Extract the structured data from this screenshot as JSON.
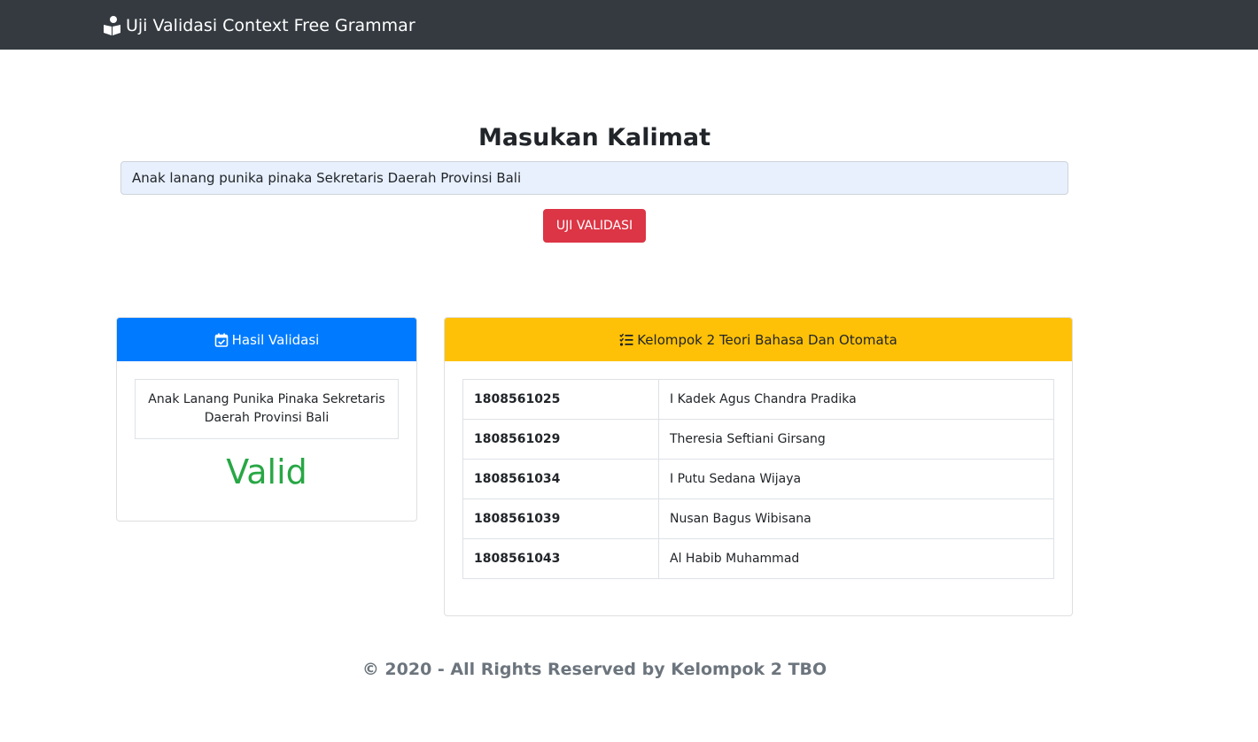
{
  "navbar": {
    "brand_icon": "book-reader-icon",
    "brand_text": "Uji Validasi Context Free Grammar"
  },
  "form": {
    "heading": "Masukan Kalimat",
    "input_value": "Anak lanang punika pinaka Sekretaris Daerah Provinsi Bali",
    "button_label": "UJI VALIDASI",
    "button_color": "#dc3545"
  },
  "result_card": {
    "header_icon": "calendar-check-icon",
    "header_label": "Hasil Validasi",
    "header_color": "#007bff",
    "sentence": "Anak Lanang Punika Pinaka Sekretaris Daerah Provinsi Bali",
    "status": "Valid",
    "status_color": "#28a745"
  },
  "group_card": {
    "header_icon": "tasks-icon",
    "header_label": "Kelompok 2 Teori Bahasa Dan Otomata",
    "header_color": "#ffc107",
    "members": [
      {
        "nim": "1808561025",
        "name": "I Kadek Agus Chandra Pradika"
      },
      {
        "nim": "1808561029",
        "name": "Theresia Seftiani Girsang"
      },
      {
        "nim": "1808561034",
        "name": "I Putu Sedana Wijaya"
      },
      {
        "nim": "1808561039",
        "name": "Nusan Bagus Wibisana"
      },
      {
        "nim": "1808561043",
        "name": "Al Habib Muhammad"
      }
    ]
  },
  "footer": {
    "text": "© 2020 - All Rights Reserved by Kelompok 2 TBO"
  }
}
